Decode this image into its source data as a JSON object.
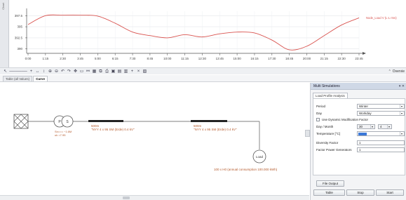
{
  "rail_label": "Chart",
  "chart": {
    "y_ticks": [
      "397.5",
      "395",
      "392.5",
      "390"
    ],
    "x_ticks": [
      "0:00",
      "1:15",
      "2:30",
      "3:45",
      "5:00",
      "6:15",
      "7:30",
      "8:45",
      "10:00",
      "11:15",
      "12:30",
      "13:45",
      "15:00",
      "16:15",
      "17:30",
      "18:45",
      "20:00",
      "21:15",
      "22:30",
      "23:45"
    ],
    "legend": "Node_Load V (L-L rms)",
    "line_color": "#d9534f"
  },
  "chart_data": {
    "type": "line",
    "title": "",
    "xlabel": "",
    "ylabel": "",
    "ylim": [
      389,
      398.5
    ],
    "grid": true,
    "legend_position": "top-right",
    "series": [
      {
        "name": "Node_Load V (L-L rms)",
        "x": [
          "0:00",
          "1:15",
          "2:30",
          "3:45",
          "5:00",
          "6:15",
          "7:30",
          "8:45",
          "10:00",
          "11:15",
          "12:30",
          "13:45",
          "15:00",
          "16:15",
          "17:30",
          "18:45",
          "20:00",
          "21:15",
          "22:30",
          "23:45"
        ],
        "values": [
          395.5,
          397.5,
          397.6,
          397.6,
          397.4,
          395.8,
          393.8,
          393.0,
          392.5,
          393.2,
          392.7,
          393.4,
          393.8,
          393.6,
          392.0,
          389.8,
          390.6,
          393.0,
          395.4,
          397.0
        ]
      }
    ]
  },
  "toolbar": {
    "icons": [
      "pointer-icon",
      "zoom-slider-icon",
      "plus-icon",
      "arrows-icon",
      "fit-icon",
      "zoom-in-icon",
      "zoom-out-icon",
      "undo-icon",
      "redo-icon",
      "pan-icon",
      "select-icon",
      "link-icon",
      "grid-icon",
      "copy-icon",
      "print-icon",
      "save-icon",
      "table-icon",
      "chart-icon",
      "add-icon",
      "close-icon",
      "export-icon"
    ],
    "overview_label": "Overvie"
  },
  "tabs": [
    "Table (all Values)",
    "Curve"
  ],
  "network": {
    "transformer_label_1": "P",
    "transformer_label_2": "S",
    "transformer_info": "Sn=== ~1.6M",
    "transformer_info2": "uk =7.95",
    "cable1_len": "500m",
    "cable1_name": "\"NYY 4 x 95 SM (Erde) 0.4 kV\"",
    "cable2_len": "500m",
    "cable2_name": "\"NYY 4 x 95 SM (Erde) 0.4 kV\"",
    "load_label": "Load",
    "load_info": "100 x H0 (annual consumption 100.000 kWh)"
  },
  "sim": {
    "title": "Multi Simulations",
    "controls": "▾ ✕",
    "tab": "Load Profile Analysis",
    "period_label": "Period",
    "period_value": "Winter",
    "day_label": "Day",
    "day_value": "Workday",
    "dynamic_label": "Use Dynamic Modification Factor",
    "daymonth_label": "Day / Month",
    "day_num": "30",
    "month_num": "4",
    "temp_label": "Temperature [°C]",
    "diversity_label": "Diversity Factor",
    "diversity_value": "1",
    "gen_label": "Factor Power Generators",
    "gen_value": "1",
    "file_output": "File Output",
    "table_btn": "Table",
    "stop_btn": "Stop",
    "start_btn": "Start"
  }
}
